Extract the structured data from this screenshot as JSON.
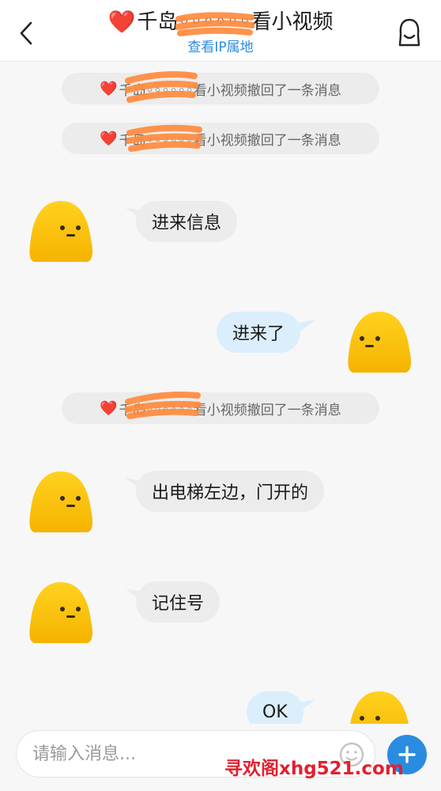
{
  "header": {
    "title_heart": "❤️",
    "title": "千岛◦◦◦◦◦◦看小视频",
    "ip_link": "查看IP属地",
    "back_icon": "chevron-left-icon",
    "profile_icon": "user-profile-icon"
  },
  "notices": [
    {
      "heart": "❤️",
      "text": "千岛◦◦◦◦◦◦看小视频撤回了一条消息"
    },
    {
      "heart": "❤️",
      "text": "千岛◦◦◦◦◦◦看小视频撤回了一条消息"
    },
    {
      "heart": "❤️",
      "text": "千岛◦◦◦◦◦◦看小视频撤回了一条消息"
    }
  ],
  "messages": [
    {
      "side": "in",
      "text": "进来信息"
    },
    {
      "side": "out",
      "text": "进来了"
    },
    {
      "side": "in",
      "text": "出电梯左边，门开的"
    },
    {
      "side": "in",
      "text": "记住号"
    },
    {
      "side": "out",
      "text": "OK"
    }
  ],
  "input": {
    "placeholder": "请输入消息..."
  },
  "watermark": "寻欢阁xhg521.com",
  "colors": {
    "accent": "#2a8ce0",
    "bubble_in": "#ececec",
    "bubble_out": "#dbeefc",
    "avatar": "#fdc419",
    "redaction": "#ff8a3d"
  }
}
